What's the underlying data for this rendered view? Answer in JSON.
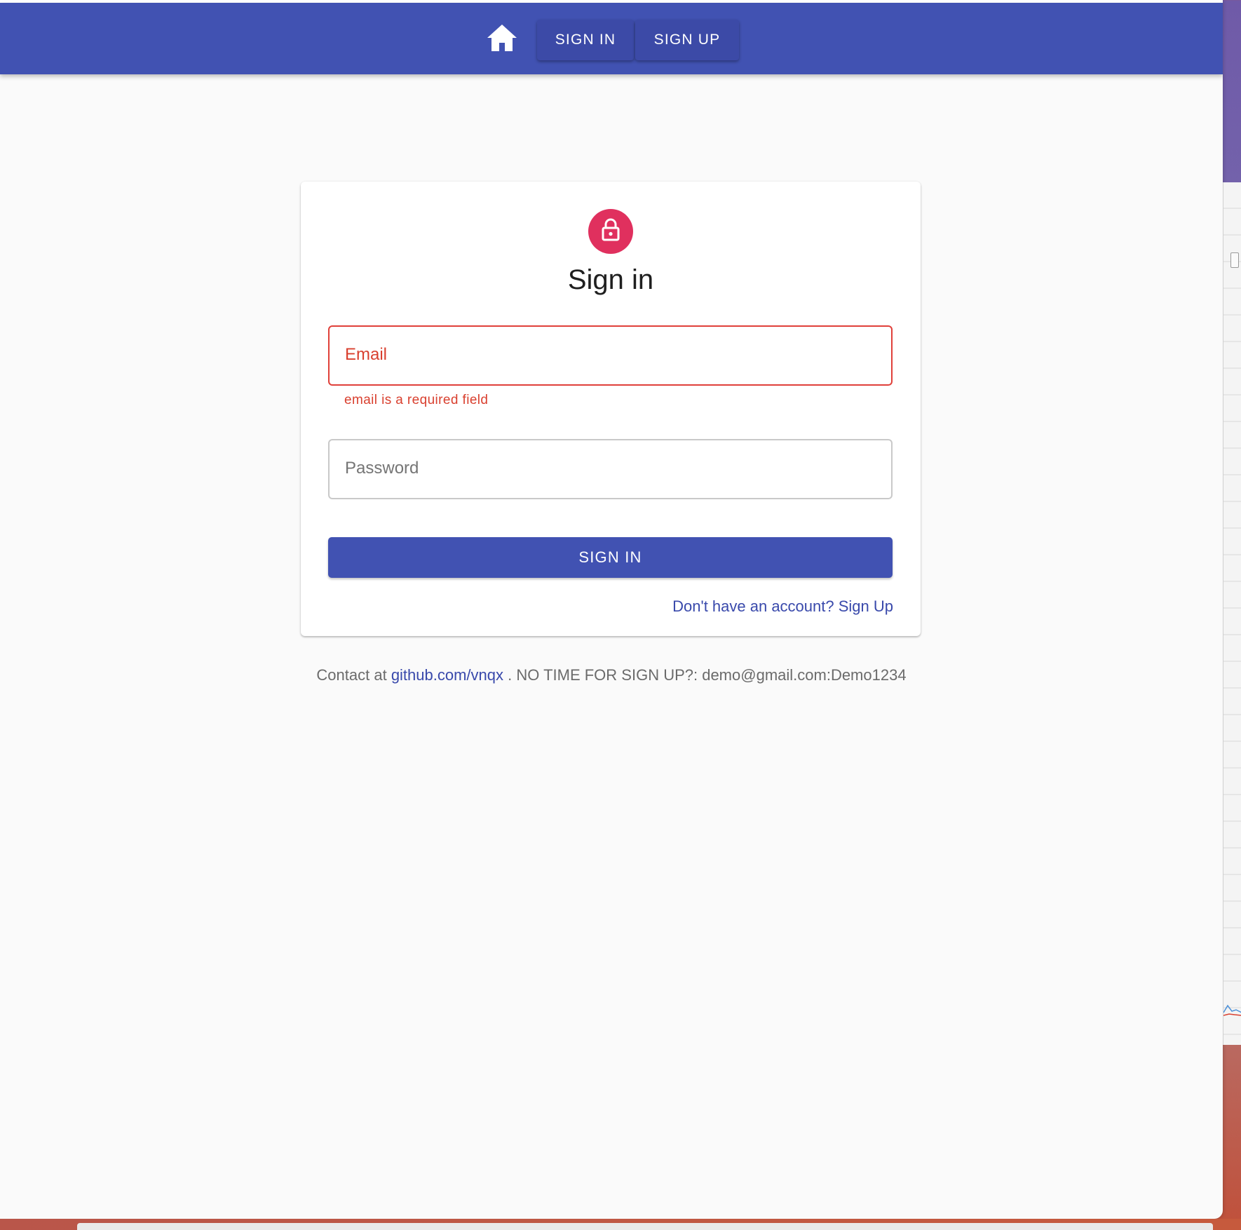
{
  "nav": {
    "home_icon": "home-icon",
    "signin_label": "SIGN IN",
    "signup_label": "SIGN UP"
  },
  "card": {
    "avatar_icon": "lock-icon",
    "title": "Sign in",
    "email": {
      "label": "Email",
      "value": "",
      "error": "email is a required field"
    },
    "password": {
      "label": "Password",
      "value": ""
    },
    "submit_label": "SIGN IN",
    "signup_link": "Don't have an account? Sign Up"
  },
  "footer": {
    "prefix": "Contact at",
    "link_text": "github.com/vnqx",
    "suffix": ". NO TIME FOR SIGN UP?: demo@gmail.com:Demo1234"
  },
  "colors": {
    "primary": "#4152b2",
    "avatar": "#e0305e",
    "error": "#d9402f",
    "link": "#3949ab"
  }
}
